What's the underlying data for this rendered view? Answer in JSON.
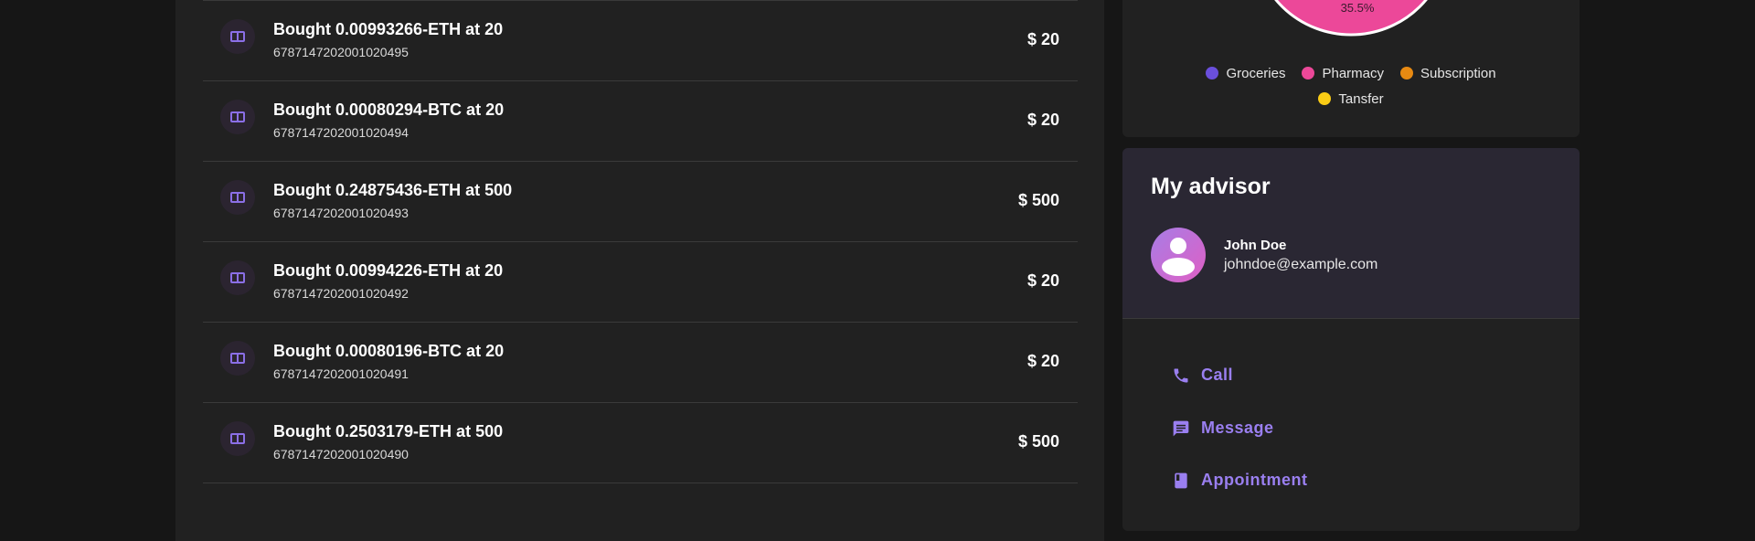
{
  "transactions": [
    {
      "title": "Bought 0.00993266-ETH at 20",
      "id": "6787147202001020495",
      "amount": "$ 20"
    },
    {
      "title": "Bought 0.00080294-BTC at 20",
      "id": "6787147202001020494",
      "amount": "$ 20"
    },
    {
      "title": "Bought 0.24875436-ETH at 500",
      "id": "6787147202001020493",
      "amount": "$ 500"
    },
    {
      "title": "Bought 0.00994226-ETH at 20",
      "id": "6787147202001020492",
      "amount": "$ 20"
    },
    {
      "title": "Bought 0.00080196-BTC at 20",
      "id": "6787147202001020491",
      "amount": "$ 20"
    },
    {
      "title": "Bought 0.2503179-ETH at 500",
      "id": "6787147202001020490",
      "amount": "$ 500"
    }
  ],
  "chart": {
    "slice_label": "35.5%",
    "legend": [
      {
        "label": "Groceries",
        "color": "#6a4fdc"
      },
      {
        "label": "Pharmacy",
        "color": "#ec4899"
      },
      {
        "label": "Subscription",
        "color": "#e88a12"
      },
      {
        "label": "Tansfer",
        "color": "#facc15"
      }
    ]
  },
  "advisor": {
    "title": "My advisor",
    "name": "John Doe",
    "email": "johndoe@example.com",
    "actions": {
      "call": "Call",
      "message": "Message",
      "appointment": "Appointment"
    }
  },
  "colors": {
    "accent": "#9a7ff0",
    "icon_bg": "#2b2430",
    "icon_fg": "#8b6fe6"
  }
}
